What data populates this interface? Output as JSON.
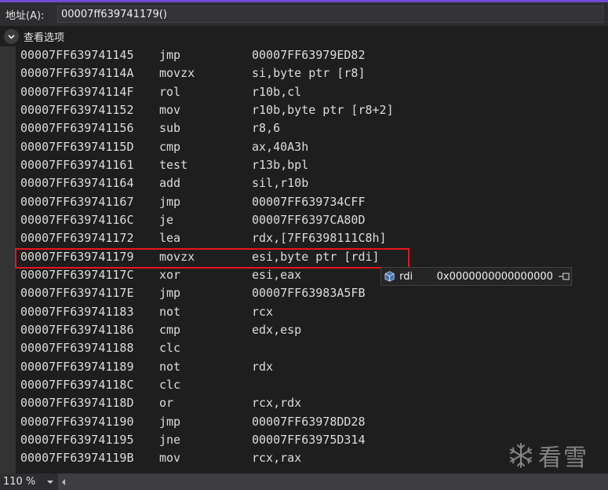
{
  "address_bar": {
    "label": "地址(A):",
    "value": "00007ff639741179()"
  },
  "view_options": {
    "label": "查看选项"
  },
  "disassembly": {
    "lines": [
      {
        "address": "00007FF639741145",
        "mnemonic": "jmp",
        "operands": "00007FF63979ED82"
      },
      {
        "address": "00007FF63974114A",
        "mnemonic": "movzx",
        "operands": "si,byte ptr [r8]"
      },
      {
        "address": "00007FF63974114F",
        "mnemonic": "rol",
        "operands": "r10b,cl"
      },
      {
        "address": "00007FF639741152",
        "mnemonic": "mov",
        "operands": "r10b,byte ptr [r8+2]"
      },
      {
        "address": "00007FF639741156",
        "mnemonic": "sub",
        "operands": "r8,6"
      },
      {
        "address": "00007FF63974115D",
        "mnemonic": "cmp",
        "operands": "ax,40A3h"
      },
      {
        "address": "00007FF639741161",
        "mnemonic": "test",
        "operands": "r13b,bpl"
      },
      {
        "address": "00007FF639741164",
        "mnemonic": "add",
        "operands": "sil,r10b"
      },
      {
        "address": "00007FF639741167",
        "mnemonic": "jmp",
        "operands": "00007FF639734CFF"
      },
      {
        "address": "00007FF63974116C",
        "mnemonic": "je",
        "operands": "00007FF6397CA80D"
      },
      {
        "address": "00007FF639741172",
        "mnemonic": "lea",
        "operands": "rdx,[7FF6398111C8h]"
      },
      {
        "address": "00007FF639741179",
        "mnemonic": "movzx",
        "operands": "esi,byte ptr [rdi]"
      },
      {
        "address": "00007FF63974117C",
        "mnemonic": "xor",
        "operands": "esi,eax"
      },
      {
        "address": "00007FF63974117E",
        "mnemonic": "jmp",
        "operands": "00007FF63983A5FB"
      },
      {
        "address": "00007FF639741183",
        "mnemonic": "not",
        "operands": "rcx"
      },
      {
        "address": "00007FF639741186",
        "mnemonic": "cmp",
        "operands": "edx,esp"
      },
      {
        "address": "00007FF639741188",
        "mnemonic": "clc",
        "operands": ""
      },
      {
        "address": "00007FF639741189",
        "mnemonic": "not",
        "operands": "rdx"
      },
      {
        "address": "00007FF63974118C",
        "mnemonic": "clc",
        "operands": ""
      },
      {
        "address": "00007FF63974118D",
        "mnemonic": "or",
        "operands": "rcx,rdx"
      },
      {
        "address": "00007FF639741190",
        "mnemonic": "jmp",
        "operands": "00007FF63978DD28"
      },
      {
        "address": "00007FF639741195",
        "mnemonic": "jne",
        "operands": "00007FF63975D314"
      },
      {
        "address": "00007FF63974119B",
        "mnemonic": "mov",
        "operands": "rcx,rax"
      }
    ]
  },
  "datatip": {
    "name": "rdi",
    "value": "0x0000000000000000",
    "icon": "register-cube-icon"
  },
  "status_bar": {
    "zoom": "110 %"
  },
  "watermark": {
    "text": "看雪",
    "icon": "snowflake-icon"
  },
  "colors": {
    "background": "#1e1e1e",
    "text": "#dcdcdc",
    "highlight_border": "#e8141c",
    "accent_strip": "#6f4bd1"
  }
}
